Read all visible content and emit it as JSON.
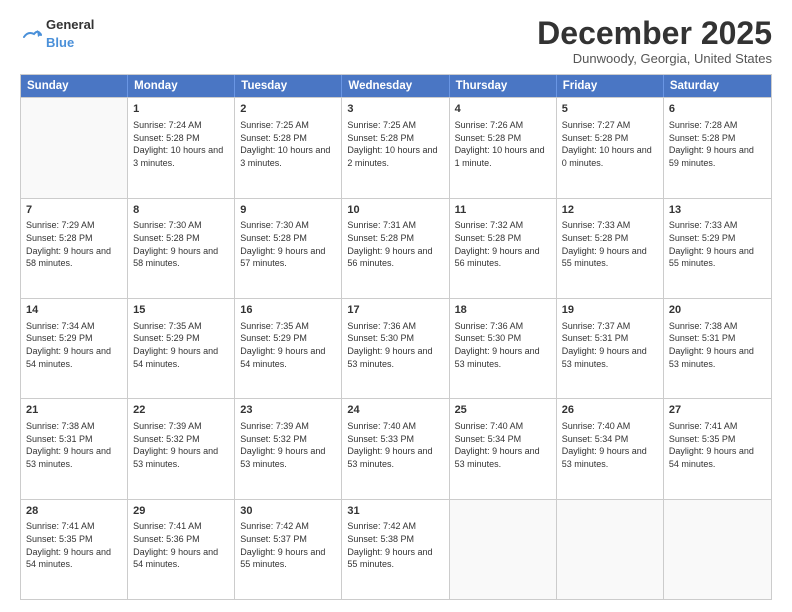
{
  "logo": {
    "general": "General",
    "blue": "Blue"
  },
  "header": {
    "month": "December 2025",
    "location": "Dunwoody, Georgia, United States"
  },
  "days": [
    "Sunday",
    "Monday",
    "Tuesday",
    "Wednesday",
    "Thursday",
    "Friday",
    "Saturday"
  ],
  "weeks": [
    [
      {
        "day": "",
        "empty": true
      },
      {
        "day": "1",
        "rise": "Sunrise: 7:24 AM",
        "set": "Sunset: 5:28 PM",
        "daylight": "Daylight: 10 hours and 3 minutes."
      },
      {
        "day": "2",
        "rise": "Sunrise: 7:25 AM",
        "set": "Sunset: 5:28 PM",
        "daylight": "Daylight: 10 hours and 3 minutes."
      },
      {
        "day": "3",
        "rise": "Sunrise: 7:25 AM",
        "set": "Sunset: 5:28 PM",
        "daylight": "Daylight: 10 hours and 2 minutes."
      },
      {
        "day": "4",
        "rise": "Sunrise: 7:26 AM",
        "set": "Sunset: 5:28 PM",
        "daylight": "Daylight: 10 hours and 1 minute."
      },
      {
        "day": "5",
        "rise": "Sunrise: 7:27 AM",
        "set": "Sunset: 5:28 PM",
        "daylight": "Daylight: 10 hours and 0 minutes."
      },
      {
        "day": "6",
        "rise": "Sunrise: 7:28 AM",
        "set": "Sunset: 5:28 PM",
        "daylight": "Daylight: 9 hours and 59 minutes."
      }
    ],
    [
      {
        "day": "7",
        "rise": "Sunrise: 7:29 AM",
        "set": "Sunset: 5:28 PM",
        "daylight": "Daylight: 9 hours and 58 minutes."
      },
      {
        "day": "8",
        "rise": "Sunrise: 7:30 AM",
        "set": "Sunset: 5:28 PM",
        "daylight": "Daylight: 9 hours and 58 minutes."
      },
      {
        "day": "9",
        "rise": "Sunrise: 7:30 AM",
        "set": "Sunset: 5:28 PM",
        "daylight": "Daylight: 9 hours and 57 minutes."
      },
      {
        "day": "10",
        "rise": "Sunrise: 7:31 AM",
        "set": "Sunset: 5:28 PM",
        "daylight": "Daylight: 9 hours and 56 minutes."
      },
      {
        "day": "11",
        "rise": "Sunrise: 7:32 AM",
        "set": "Sunset: 5:28 PM",
        "daylight": "Daylight: 9 hours and 56 minutes."
      },
      {
        "day": "12",
        "rise": "Sunrise: 7:33 AM",
        "set": "Sunset: 5:28 PM",
        "daylight": "Daylight: 9 hours and 55 minutes."
      },
      {
        "day": "13",
        "rise": "Sunrise: 7:33 AM",
        "set": "Sunset: 5:29 PM",
        "daylight": "Daylight: 9 hours and 55 minutes."
      }
    ],
    [
      {
        "day": "14",
        "rise": "Sunrise: 7:34 AM",
        "set": "Sunset: 5:29 PM",
        "daylight": "Daylight: 9 hours and 54 minutes."
      },
      {
        "day": "15",
        "rise": "Sunrise: 7:35 AM",
        "set": "Sunset: 5:29 PM",
        "daylight": "Daylight: 9 hours and 54 minutes."
      },
      {
        "day": "16",
        "rise": "Sunrise: 7:35 AM",
        "set": "Sunset: 5:29 PM",
        "daylight": "Daylight: 9 hours and 54 minutes."
      },
      {
        "day": "17",
        "rise": "Sunrise: 7:36 AM",
        "set": "Sunset: 5:30 PM",
        "daylight": "Daylight: 9 hours and 53 minutes."
      },
      {
        "day": "18",
        "rise": "Sunrise: 7:36 AM",
        "set": "Sunset: 5:30 PM",
        "daylight": "Daylight: 9 hours and 53 minutes."
      },
      {
        "day": "19",
        "rise": "Sunrise: 7:37 AM",
        "set": "Sunset: 5:31 PM",
        "daylight": "Daylight: 9 hours and 53 minutes."
      },
      {
        "day": "20",
        "rise": "Sunrise: 7:38 AM",
        "set": "Sunset: 5:31 PM",
        "daylight": "Daylight: 9 hours and 53 minutes."
      }
    ],
    [
      {
        "day": "21",
        "rise": "Sunrise: 7:38 AM",
        "set": "Sunset: 5:31 PM",
        "daylight": "Daylight: 9 hours and 53 minutes."
      },
      {
        "day": "22",
        "rise": "Sunrise: 7:39 AM",
        "set": "Sunset: 5:32 PM",
        "daylight": "Daylight: 9 hours and 53 minutes."
      },
      {
        "day": "23",
        "rise": "Sunrise: 7:39 AM",
        "set": "Sunset: 5:32 PM",
        "daylight": "Daylight: 9 hours and 53 minutes."
      },
      {
        "day": "24",
        "rise": "Sunrise: 7:40 AM",
        "set": "Sunset: 5:33 PM",
        "daylight": "Daylight: 9 hours and 53 minutes."
      },
      {
        "day": "25",
        "rise": "Sunrise: 7:40 AM",
        "set": "Sunset: 5:34 PM",
        "daylight": "Daylight: 9 hours and 53 minutes."
      },
      {
        "day": "26",
        "rise": "Sunrise: 7:40 AM",
        "set": "Sunset: 5:34 PM",
        "daylight": "Daylight: 9 hours and 53 minutes."
      },
      {
        "day": "27",
        "rise": "Sunrise: 7:41 AM",
        "set": "Sunset: 5:35 PM",
        "daylight": "Daylight: 9 hours and 54 minutes."
      }
    ],
    [
      {
        "day": "28",
        "rise": "Sunrise: 7:41 AM",
        "set": "Sunset: 5:35 PM",
        "daylight": "Daylight: 9 hours and 54 minutes."
      },
      {
        "day": "29",
        "rise": "Sunrise: 7:41 AM",
        "set": "Sunset: 5:36 PM",
        "daylight": "Daylight: 9 hours and 54 minutes."
      },
      {
        "day": "30",
        "rise": "Sunrise: 7:42 AM",
        "set": "Sunset: 5:37 PM",
        "daylight": "Daylight: 9 hours and 55 minutes."
      },
      {
        "day": "31",
        "rise": "Sunrise: 7:42 AM",
        "set": "Sunset: 5:38 PM",
        "daylight": "Daylight: 9 hours and 55 minutes."
      },
      {
        "day": "",
        "empty": true
      },
      {
        "day": "",
        "empty": true
      },
      {
        "day": "",
        "empty": true
      }
    ]
  ]
}
